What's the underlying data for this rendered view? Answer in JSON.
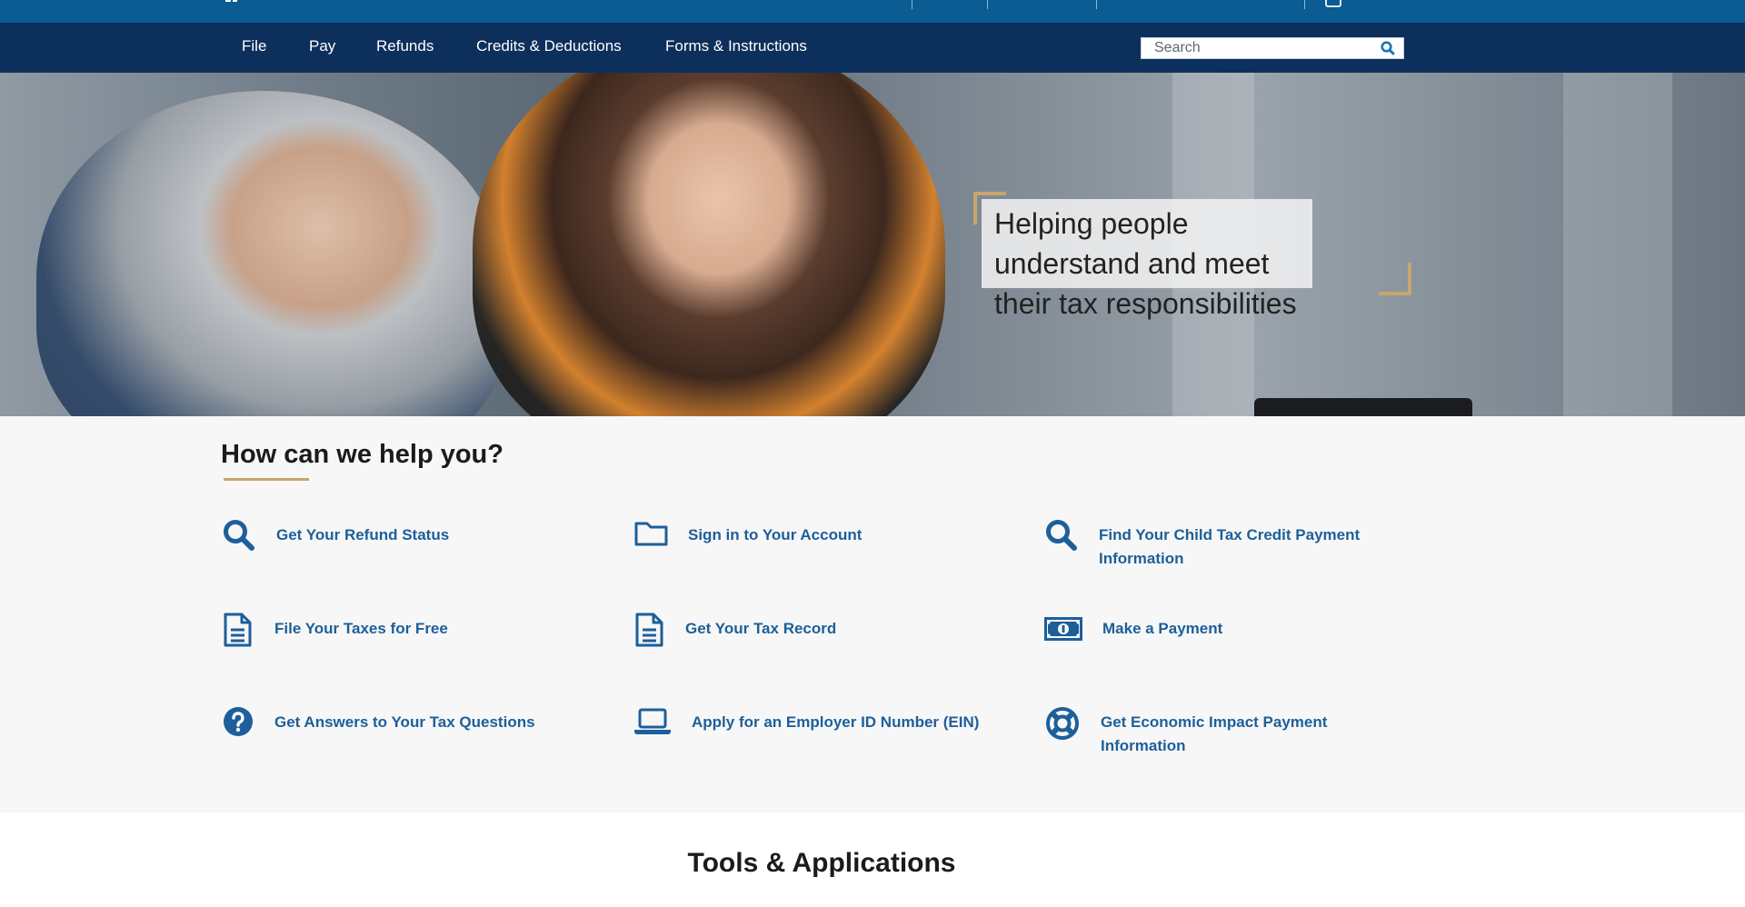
{
  "nav": {
    "items": [
      {
        "label": "File"
      },
      {
        "label": "Pay"
      },
      {
        "label": "Refunds"
      },
      {
        "label": "Credits & Deductions"
      },
      {
        "label": "Forms & Instructions"
      }
    ],
    "search": {
      "placeholder": "Search"
    }
  },
  "hero": {
    "tagline": "Helping people understand and meet their tax responsibilities"
  },
  "help": {
    "title": "How can we help you?",
    "items": [
      {
        "label": "Get Your Refund Status",
        "icon": "search-icon"
      },
      {
        "label": "Sign in to Your Account",
        "icon": "folder-icon"
      },
      {
        "label": "Find Your Child Tax Credit Payment Information",
        "icon": "search-icon"
      },
      {
        "label": "File Your Taxes for Free",
        "icon": "document-icon"
      },
      {
        "label": "Get Your Tax Record",
        "icon": "document-icon"
      },
      {
        "label": "Make a Payment",
        "icon": "money-icon"
      },
      {
        "label": "Get Answers to Your Tax Questions",
        "icon": "question-circle-icon"
      },
      {
        "label": "Apply for an Employer ID Number (EIN)",
        "icon": "laptop-icon"
      },
      {
        "label": "Get Economic Impact Payment Information",
        "icon": "life-ring-icon"
      }
    ]
  },
  "tools": {
    "title": "Tools & Applications"
  },
  "colors": {
    "nav_bg": "#0d2f5c",
    "top_strip": "#0b5c92",
    "link_blue": "#1d5f9a",
    "accent_gold": "#c9a56b"
  }
}
